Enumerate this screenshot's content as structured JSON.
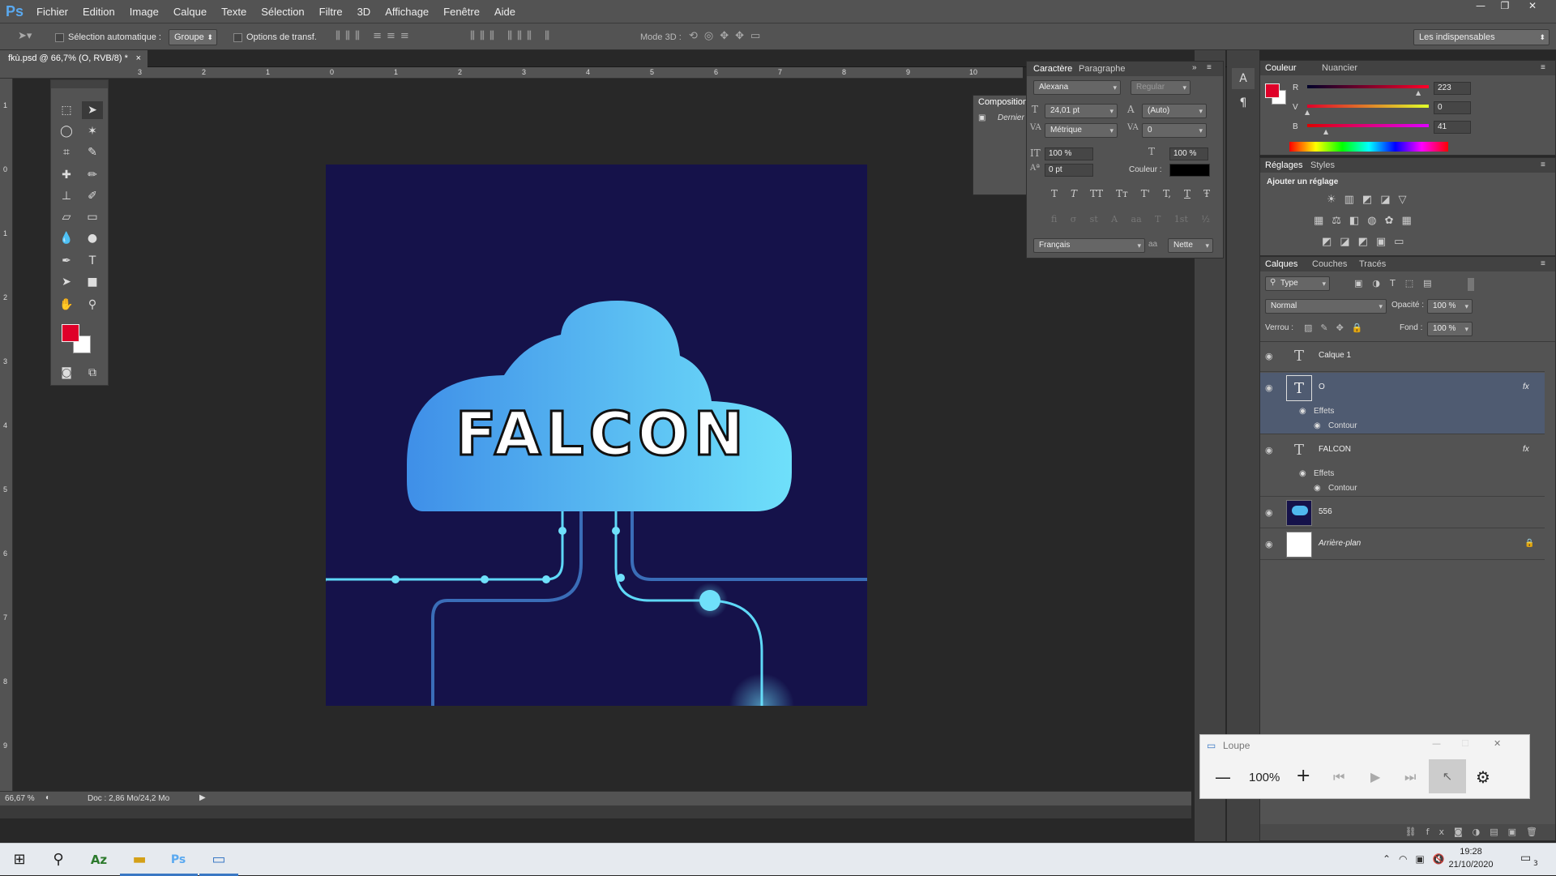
{
  "app": {
    "logo": "Ps"
  },
  "menu": [
    "Fichier",
    "Edition",
    "Image",
    "Calque",
    "Texte",
    "Sélection",
    "Filtre",
    "3D",
    "Affichage",
    "Fenêtre",
    "Aide"
  ],
  "options": {
    "auto_select": "Sélection automatique :",
    "group": "Groupe",
    "transform": "Options de transf.",
    "mode3d": "Mode 3D :",
    "workspace": "Les indispensables"
  },
  "document": {
    "tab": "fkù.psd @ 66,7% (O, RVB/8) *",
    "close": "×"
  },
  "rulers": {
    "h": [
      "3",
      "2",
      "1",
      "0",
      "1",
      "2",
      "3",
      "4",
      "5",
      "6",
      "7",
      "8",
      "9",
      "10"
    ],
    "v": [
      "1",
      "0",
      "1",
      "2",
      "3",
      "4",
      "5",
      "6",
      "7",
      "8",
      "9"
    ]
  },
  "canvas": {
    "logo_text": "FALCON"
  },
  "status": {
    "zoom": "66,67 %",
    "doc": "Doc : 2,86 Mo/24,2 Mo"
  },
  "composition": {
    "tab": "Composition",
    "item": "Dernier"
  },
  "character": {
    "tabs": [
      "Caractère",
      "Paragraphe"
    ],
    "font": "Alexana",
    "style": "Regular",
    "size": "24,01 pt",
    "leading": "(Auto)",
    "kerning": "Métrique",
    "tracking": "0",
    "vscale": "100 %",
    "hscale": "100 %",
    "baseline": "0 pt",
    "color_label": "Couleur :",
    "language": "Français",
    "aa_label": "aa",
    "antialias": "Nette",
    "style_glyphs": [
      "T",
      "T",
      "TT",
      "Tт",
      "T'",
      "T,",
      "T",
      "Ŧ"
    ],
    "ot_glyphs": [
      "fi",
      "σ",
      "st",
      "A",
      "aa",
      "T",
      "1st",
      "½"
    ]
  },
  "color_panel": {
    "tabs": [
      "Couleur",
      "Nuancier"
    ],
    "channels": [
      {
        "label": "R",
        "value": "223"
      },
      {
        "label": "V",
        "value": "0"
      },
      {
        "label": "B",
        "value": "41"
      }
    ],
    "fg": "#df0029"
  },
  "adjustments": {
    "tabs": [
      "Réglages",
      "Styles"
    ],
    "title": "Ajouter un réglage"
  },
  "layers_panel": {
    "tabs": [
      "Calques",
      "Couches",
      "Tracés"
    ],
    "filter": "Type",
    "blend": "Normal",
    "opacity_label": "Opacité :",
    "opacity": "100 %",
    "lock_label": "Verrou :",
    "fill_label": "Fond :",
    "fill": "100 %",
    "layers": [
      {
        "name": "Calque 1",
        "kind": "text"
      },
      {
        "name": "O",
        "kind": "text",
        "fx": "fx",
        "effects": "Effets",
        "stroke": "Contour"
      },
      {
        "name": "FALCON",
        "kind": "text",
        "fx": "fx",
        "effects": "Effets",
        "stroke": "Contour"
      },
      {
        "name": "556",
        "kind": "image"
      },
      {
        "name": "Arrière-plan",
        "kind": "bg"
      }
    ]
  },
  "magnifier": {
    "title": "Loupe",
    "zoom": "100%"
  },
  "taskbar": {
    "time": "19:28",
    "date": "21/10/2020",
    "notif": "3"
  }
}
